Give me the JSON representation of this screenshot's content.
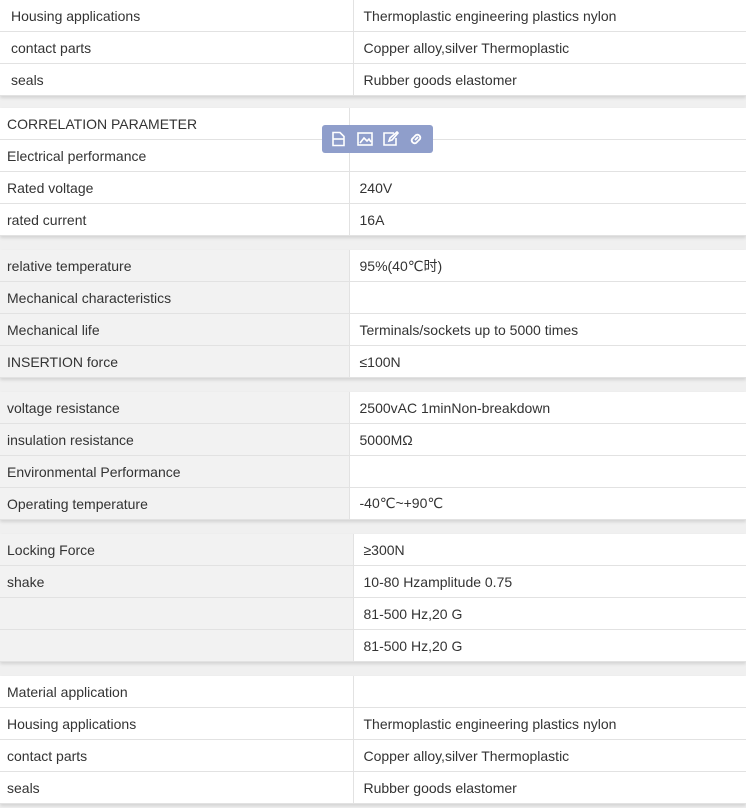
{
  "tables": [
    {
      "rows": [
        [
          "Housing applications",
          "Thermoplastic engineering plastics nylon"
        ],
        [
          "contact parts",
          "Copper alloy,silver Thermoplastic"
        ],
        [
          "seals",
          "Rubber goods elastomer"
        ]
      ]
    },
    {
      "rows": [
        [
          "CORRELATION PARAMETER",
          ""
        ],
        [
          "Electrical performance",
          ""
        ],
        [
          "Rated voltage",
          "240V"
        ],
        [
          "rated current",
          "16A"
        ]
      ]
    },
    {
      "rows": [
        [
          "relative temperature",
          "95%(40℃时)"
        ],
        [
          "Mechanical characteristics",
          ""
        ],
        [
          "Mechanical life",
          "Terminals/sockets up to 5000 times"
        ],
        [
          "INSERTION force",
          "≤100N"
        ]
      ]
    },
    {
      "rows": [
        [
          "voltage resistance",
          "2500vAC 1minNon-breakdown"
        ],
        [
          "insulation resistance",
          "5000MΩ"
        ],
        [
          "Environmental Performance",
          ""
        ],
        [
          "Operating temperature",
          "-40℃~+90℃"
        ]
      ]
    },
    {
      "rows": [
        [
          "Locking Force",
          "≥300N"
        ],
        [
          "shake",
          "10-80 Hzamplitude 0.75"
        ],
        [
          "",
          "81-500 Hz,20 G"
        ],
        [
          "",
          "81-500 Hz,20 G"
        ]
      ]
    },
    {
      "rows": [
        [
          "Material application",
          ""
        ],
        [
          "Housing applications",
          "Thermoplastic engineering plastics nylon"
        ],
        [
          "contact parts",
          "Copper alloy,silver Thermoplastic"
        ],
        [
          "seals",
          "Rubber goods elastomer"
        ]
      ]
    }
  ],
  "toolbar": {
    "icons": [
      "file-icon",
      "image-icon",
      "edit-icon",
      "link-icon"
    ]
  }
}
